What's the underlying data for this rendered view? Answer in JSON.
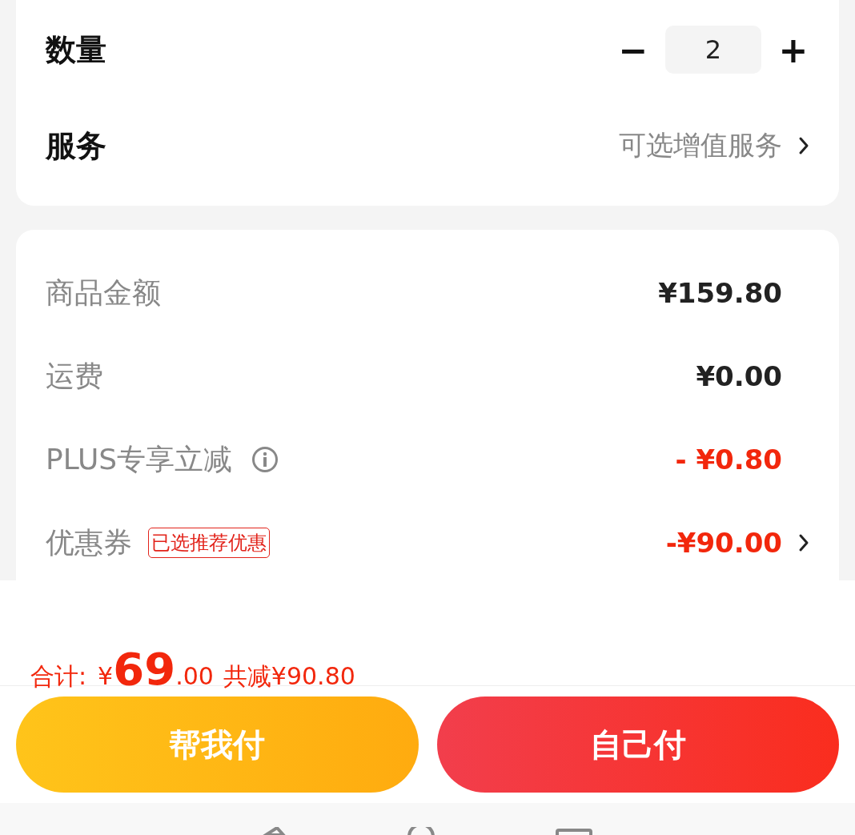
{
  "options": {
    "quantity": {
      "label": "数量",
      "minus": "−",
      "value": "2",
      "plus": "+"
    },
    "service": {
      "label": "服务",
      "value": "可选增值服务"
    }
  },
  "summary": [
    {
      "kind": "plain",
      "label": "商品金额",
      "value": "¥159.80",
      "highlight": false
    },
    {
      "kind": "plain",
      "label": "运费",
      "value": "¥0.00",
      "highlight": false
    },
    {
      "kind": "info",
      "label": "PLUS专享立减",
      "value": "- ¥0.80",
      "highlight": true
    },
    {
      "kind": "coupon",
      "label": "优惠券",
      "tag": "已选推荐优惠",
      "value": "-¥90.00",
      "highlight": true
    }
  ],
  "total": {
    "label": "合计:",
    "currency": "¥",
    "integer": "69",
    "decimal": ".00",
    "savings": "共减¥90.80"
  },
  "buttons": [
    {
      "kind": "secondary",
      "label": "帮我付"
    },
    {
      "kind": "primary",
      "label": "自己付"
    }
  ]
}
